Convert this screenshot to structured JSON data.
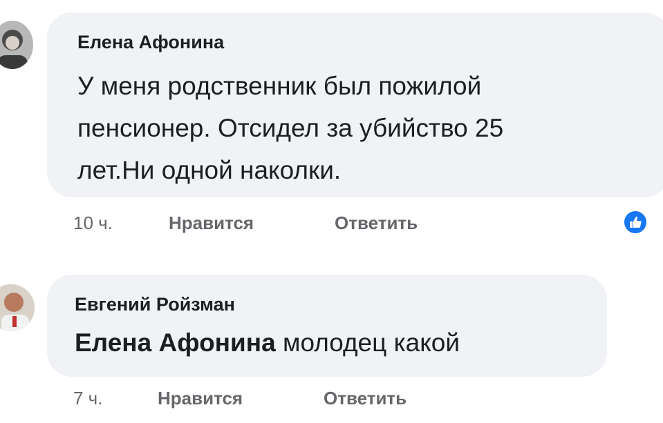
{
  "comments": [
    {
      "author": "Елена Афонина",
      "text_lines": [
        "У меня родственник был пожилой",
        "пенсионер. Отсидел за убийство 25",
        "лет.Ни одной наколки."
      ],
      "time": "10 ч.",
      "like_label": "Нравится",
      "reply_label": "Ответить",
      "reaction_icon": "like-reaction-icon"
    },
    {
      "author": "Евгений Ройзман",
      "mention": "Елена Афонина",
      "text_rest": "молодец какой",
      "time": "7 ч.",
      "like_label": "Нравится",
      "reply_label": "Ответить"
    }
  ],
  "colors": {
    "bubble": "#f0f2f5",
    "secondary_text": "#65676b",
    "like_blue": "#1877f2"
  }
}
